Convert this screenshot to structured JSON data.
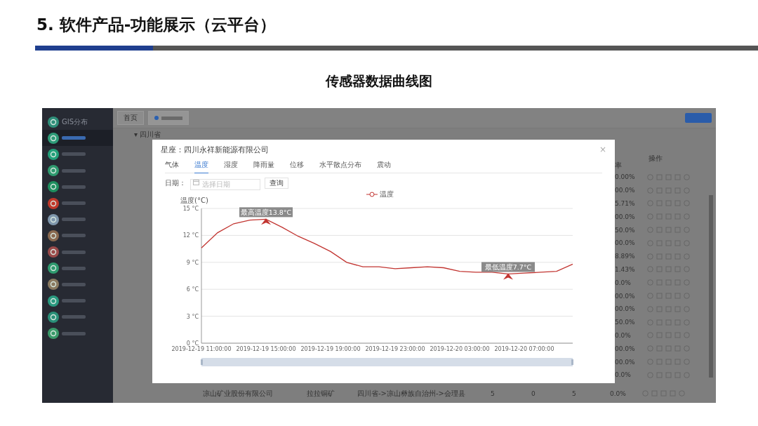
{
  "slide": {
    "title": "5. 软件产品-功能展示（云平台）",
    "subtitle": "传感器数据曲线图"
  },
  "sidebar": {
    "items": [
      {
        "label": "GIS分布",
        "color": "#2f8f7a",
        "selected": false
      },
      {
        "color": "#2e9b78",
        "selected": true
      },
      {
        "color": "#22a07a",
        "selected": false
      },
      {
        "color": "#2f9a6f",
        "selected": false
      },
      {
        "color": "#1f8f5f",
        "selected": false
      },
      {
        "color": "#c0392b",
        "selected": false
      },
      {
        "color": "#7f97ad",
        "selected": false
      },
      {
        "color": "#8a6a50",
        "selected": false
      },
      {
        "color": "#9a4a4a",
        "selected": false
      },
      {
        "color": "#2f9a6f",
        "selected": false
      },
      {
        "color": "#8a7a60",
        "selected": false
      },
      {
        "color": "#2a9a80",
        "selected": false
      },
      {
        "color": "#2a8f78",
        "selected": false
      },
      {
        "color": "#3a9a6a",
        "selected": false
      }
    ]
  },
  "tabbar": {
    "tabs": [
      {
        "label": "首页",
        "selected": false
      },
      {
        "selected": true
      }
    ]
  },
  "region": "▾ 四川省",
  "table": {
    "rate_header": "率",
    "action_header": "操作",
    "rows": [
      {
        "rate": "0.00%"
      },
      {
        "rate": "00.0%"
      },
      {
        "rate": "5.71%"
      },
      {
        "rate": "00.0%"
      },
      {
        "rate": "50.0%"
      },
      {
        "rate": "00.0%"
      },
      {
        "rate": "8.89%"
      },
      {
        "rate": "1.43%"
      },
      {
        "rate": "0.0%"
      },
      {
        "rate": "00.0%"
      },
      {
        "rate": "00.0%"
      },
      {
        "rate": "50.0%"
      },
      {
        "rate": "0.0%"
      },
      {
        "rate": "00.0%"
      },
      {
        "rate": "00.0%"
      },
      {
        "rate": "0.0%"
      }
    ],
    "last_row": {
      "company": "凉山矿业股份有限公司",
      "mine": "拉拉铜矿",
      "location": "四川省->凉山彝族自治州->会理县",
      "column_4": "5",
      "column_5": "0",
      "column_6": "5",
      "rate": "0.0%"
    }
  },
  "dialog": {
    "title": "星座：四川永祥新能源有限公司",
    "close": "×",
    "tabs": [
      {
        "label": "气体",
        "selected": false
      },
      {
        "label": "温度",
        "selected": true
      },
      {
        "label": "湿度",
        "selected": false
      },
      {
        "label": "降雨量",
        "selected": false
      },
      {
        "label": "位移",
        "selected": false
      },
      {
        "label": "水平散点分布",
        "selected": false
      },
      {
        "label": "震动",
        "selected": false
      }
    ],
    "date_label": "日期：",
    "date_placeholder": "选择日期",
    "query_button": "查询",
    "chart_data": {
      "type": "line",
      "ylabel": "温度(°C)",
      "categories": [
        "2019-12-19 11:00:00",
        null,
        null,
        null,
        "2019-12-19 15:00:00",
        null,
        null,
        null,
        "2019-12-19 19:00:00",
        null,
        null,
        null,
        "2019-12-19 23:00:00",
        null,
        null,
        null,
        "2019-12-20 03:00:00",
        null,
        null,
        null,
        "2019-12-20 07:00:00",
        null,
        null,
        null
      ],
      "series": [
        {
          "name": "温度",
          "color": "#c23531",
          "values": [
            10.6,
            12.3,
            13.3,
            13.7,
            13.8,
            12.9,
            11.9,
            11.1,
            10.2,
            9.0,
            8.5,
            8.5,
            8.3,
            8.4,
            8.5,
            8.4,
            8.0,
            7.9,
            7.9,
            7.7,
            7.8,
            7.9,
            8.0,
            8.8
          ]
        }
      ],
      "ylim": [
        0,
        15
      ],
      "yticks": [
        {
          "value": 0,
          "label": "0 °C"
        },
        {
          "value": 3,
          "label": "3 °C"
        },
        {
          "value": 6,
          "label": "6 °C"
        },
        {
          "value": 9,
          "label": "9 °C"
        },
        {
          "value": 12,
          "label": "12 °C"
        },
        {
          "value": 15,
          "label": "15 °C"
        }
      ],
      "grid": true,
      "annotations": [
        {
          "y": 13.8,
          "text": "最高温度13.8°C"
        },
        {
          "y": 7.7,
          "text": "最低温度7.7°C"
        }
      ]
    }
  }
}
